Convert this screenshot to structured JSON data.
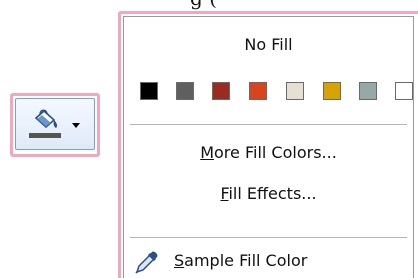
{
  "background_fragment": "g ( ",
  "fill_button": {
    "icon": "paint-bucket-icon",
    "current_color": "#555555",
    "dropdown_icon": "dropdown-arrow-icon"
  },
  "menu": {
    "no_fill_label": "No Fill",
    "swatches": [
      {
        "name": "Black",
        "color": "#000000"
      },
      {
        "name": "Dark Gray",
        "color": "#5f5f5f"
      },
      {
        "name": "Dark Red",
        "color": "#9b2a21"
      },
      {
        "name": "Orange Red",
        "color": "#d9441c"
      },
      {
        "name": "Light Beige",
        "color": "#e6e0d3"
      },
      {
        "name": "Gold",
        "color": "#d6a300"
      },
      {
        "name": "Gray Blue",
        "color": "#97a8a9"
      },
      {
        "name": "White",
        "color": "#ffffff"
      }
    ],
    "more_fill_colors": {
      "mnemonic": "M",
      "rest": "ore Fill Colors..."
    },
    "fill_effects": {
      "mnemonic": "F",
      "rest": "ill Effects..."
    },
    "sample_fill_color": {
      "mnemonic": "S",
      "rest": "ample Fill Color",
      "icon": "eyedropper-icon"
    }
  }
}
